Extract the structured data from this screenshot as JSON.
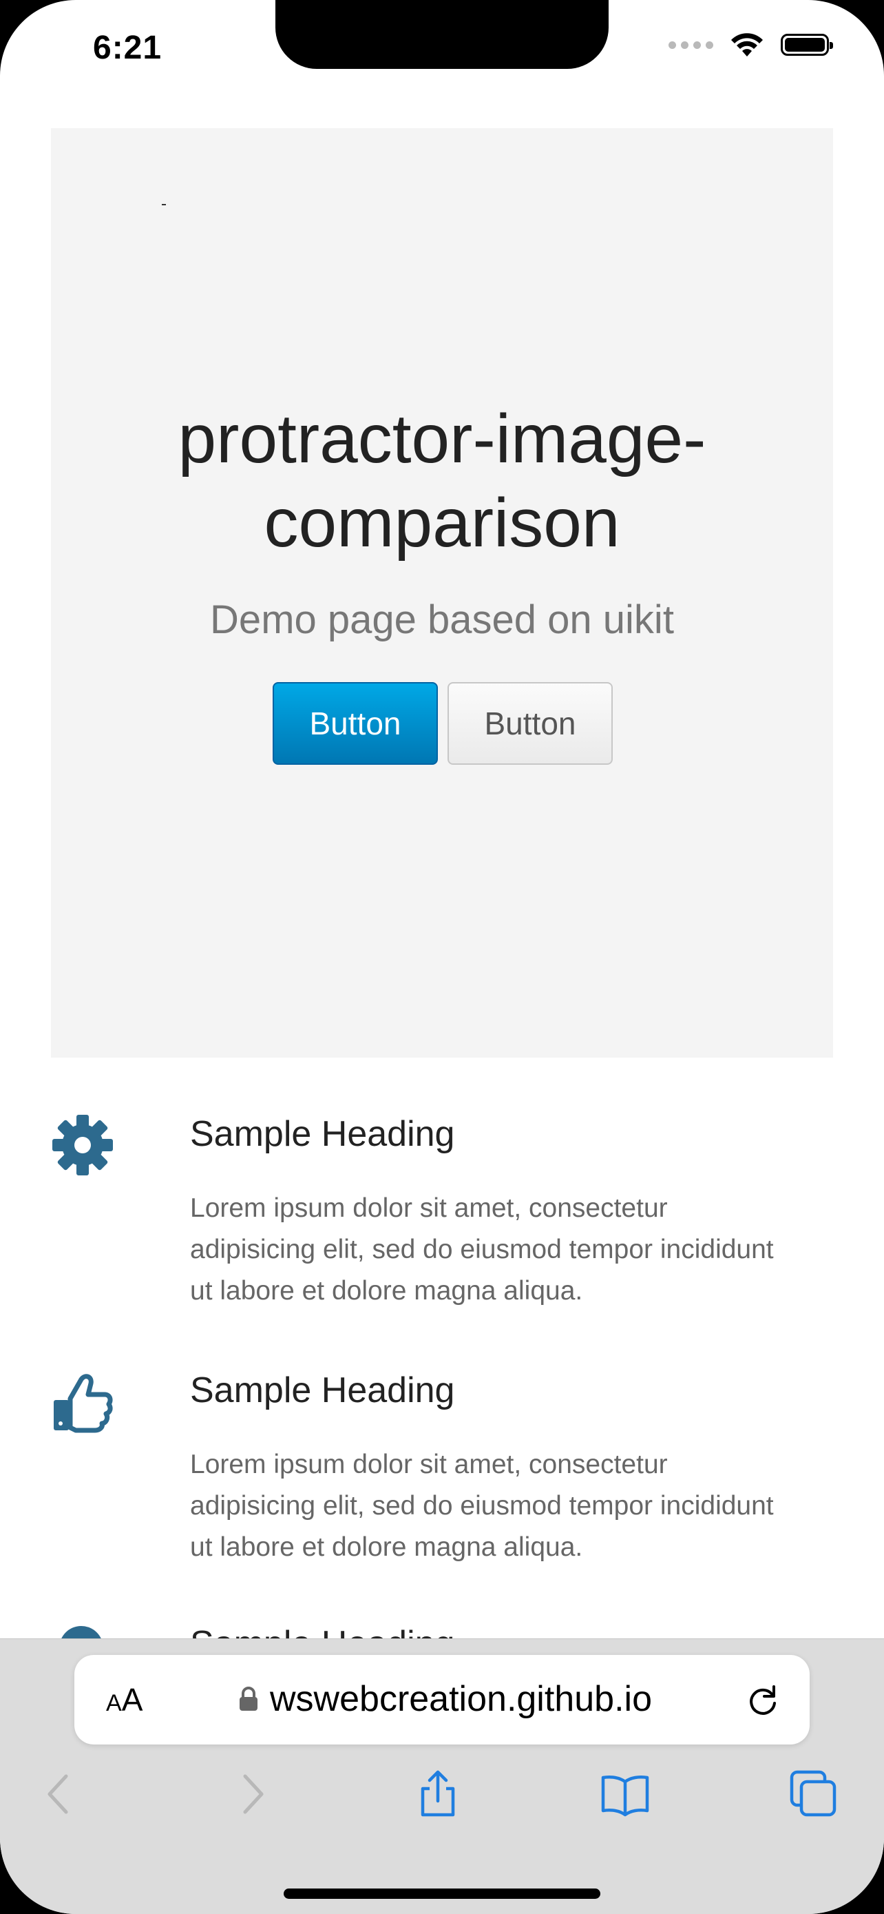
{
  "status": {
    "time": "6:21"
  },
  "hero": {
    "title": "protractor-image-comparison",
    "subtitle": "Demo page based on uikit",
    "primary_button": "Button",
    "default_button": "Button"
  },
  "features": [
    {
      "icon": "gear-icon",
      "heading": "Sample Heading",
      "text": "Lorem ipsum dolor sit amet, consectetur adipisicing elit, sed do eiusmod tempor incididunt ut labore et dolore magna aliqua."
    },
    {
      "icon": "thumbs-up-icon",
      "heading": "Sample Heading",
      "text": "Lorem ipsum dolor sit amet, consectetur adipisicing elit, sed do eiusmod tempor incididunt ut labore et dolore magna aliqua."
    },
    {
      "icon": "partially-visible-icon",
      "heading": "Sample Heading"
    }
  ],
  "browser": {
    "text_size_small": "A",
    "text_size_large": "A",
    "url": "wswebcreation.github.io"
  },
  "colors": {
    "accent": "#00a8e6",
    "icon": "#2d6a8e",
    "toolbar_icons": "#1f7ee0"
  }
}
